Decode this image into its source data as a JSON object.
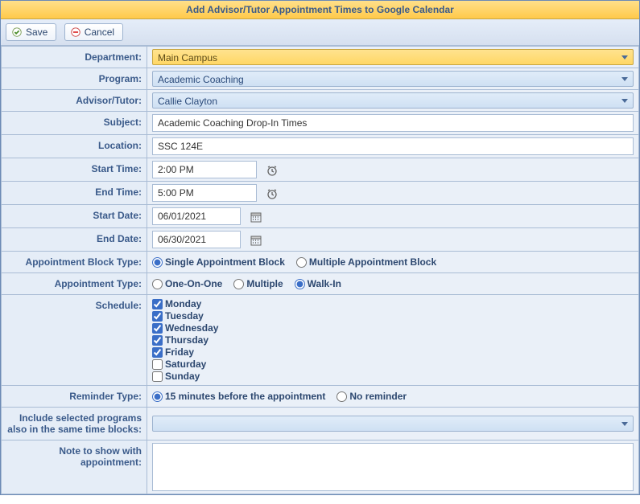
{
  "title": "Add Advisor/Tutor Appointment Times to Google Calendar",
  "toolbar": {
    "save": "Save",
    "cancel": "Cancel"
  },
  "labels": {
    "department": "Department:",
    "program": "Program:",
    "advisor": "Advisor/Tutor:",
    "subject": "Subject:",
    "location": "Location:",
    "startTime": "Start Time:",
    "endTime": "End Time:",
    "startDate": "Start Date:",
    "endDate": "End Date:",
    "apptBlockType": "Appointment Block Type:",
    "apptType": "Appointment Type:",
    "schedule": "Schedule:",
    "reminder": "Reminder Type:",
    "includePrograms": "Include selected programs also in the same time blocks:",
    "note": "Note to show with appointment:"
  },
  "values": {
    "department": "Main Campus",
    "program": "Academic Coaching",
    "advisor": "Callie Clayton",
    "subject": "Academic Coaching Drop-In Times",
    "location": "SSC 124E",
    "startTime": "2:00 PM",
    "endTime": "5:00 PM",
    "startDate": "06/01/2021",
    "endDate": "06/30/2021",
    "includePrograms": "",
    "note": ""
  },
  "apptBlockType": {
    "options": [
      "Single Appointment Block",
      "Multiple Appointment Block"
    ],
    "selected": "Single Appointment Block"
  },
  "apptType": {
    "options": [
      "One-On-One",
      "Multiple",
      "Walk-In"
    ],
    "selected": "Walk-In"
  },
  "schedule": [
    {
      "day": "Monday",
      "checked": true
    },
    {
      "day": "Tuesday",
      "checked": true
    },
    {
      "day": "Wednesday",
      "checked": true
    },
    {
      "day": "Thursday",
      "checked": true
    },
    {
      "day": "Friday",
      "checked": true
    },
    {
      "day": "Saturday",
      "checked": false
    },
    {
      "day": "Sunday",
      "checked": false
    }
  ],
  "reminder": {
    "options": [
      "15 minutes before the appointment",
      "No reminder"
    ],
    "selected": "15 minutes before the appointment"
  }
}
